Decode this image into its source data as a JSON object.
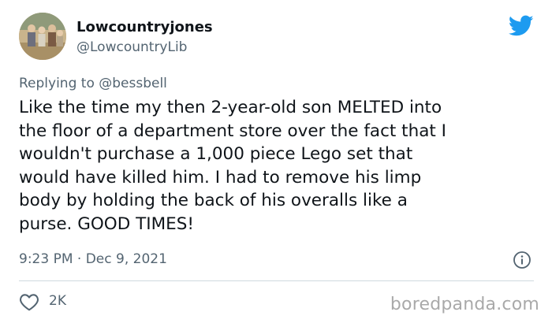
{
  "author": {
    "display_name": "Lowcountryjones",
    "handle": "@LowcountryLib"
  },
  "reply": {
    "prefix": "Replying to",
    "to_handle": "@bessbell"
  },
  "tweet": {
    "lines": [
      "Like the time my then 2-year-old son MELTED into",
      "the floor of a department store over the fact that I",
      "wouldn't purchase a 1,000 piece Lego set that",
      "would have killed him. I had to remove his limp",
      "body by holding the back of his overalls like a",
      "purse. GOOD TIMES!"
    ],
    "timestamp": "9:23 PM · Dec 9, 2021"
  },
  "stats": {
    "likes": "2K"
  },
  "watermark": "boredpanda.com",
  "icons": {
    "brand": "twitter-bird-icon",
    "info": "info-icon",
    "like": "heart-icon"
  },
  "colors": {
    "twitter_blue": "#1d9bf0",
    "text_primary": "#0f1419",
    "text_secondary": "#536471",
    "divider": "#cfd9de",
    "watermark": "#a9a9a9"
  }
}
